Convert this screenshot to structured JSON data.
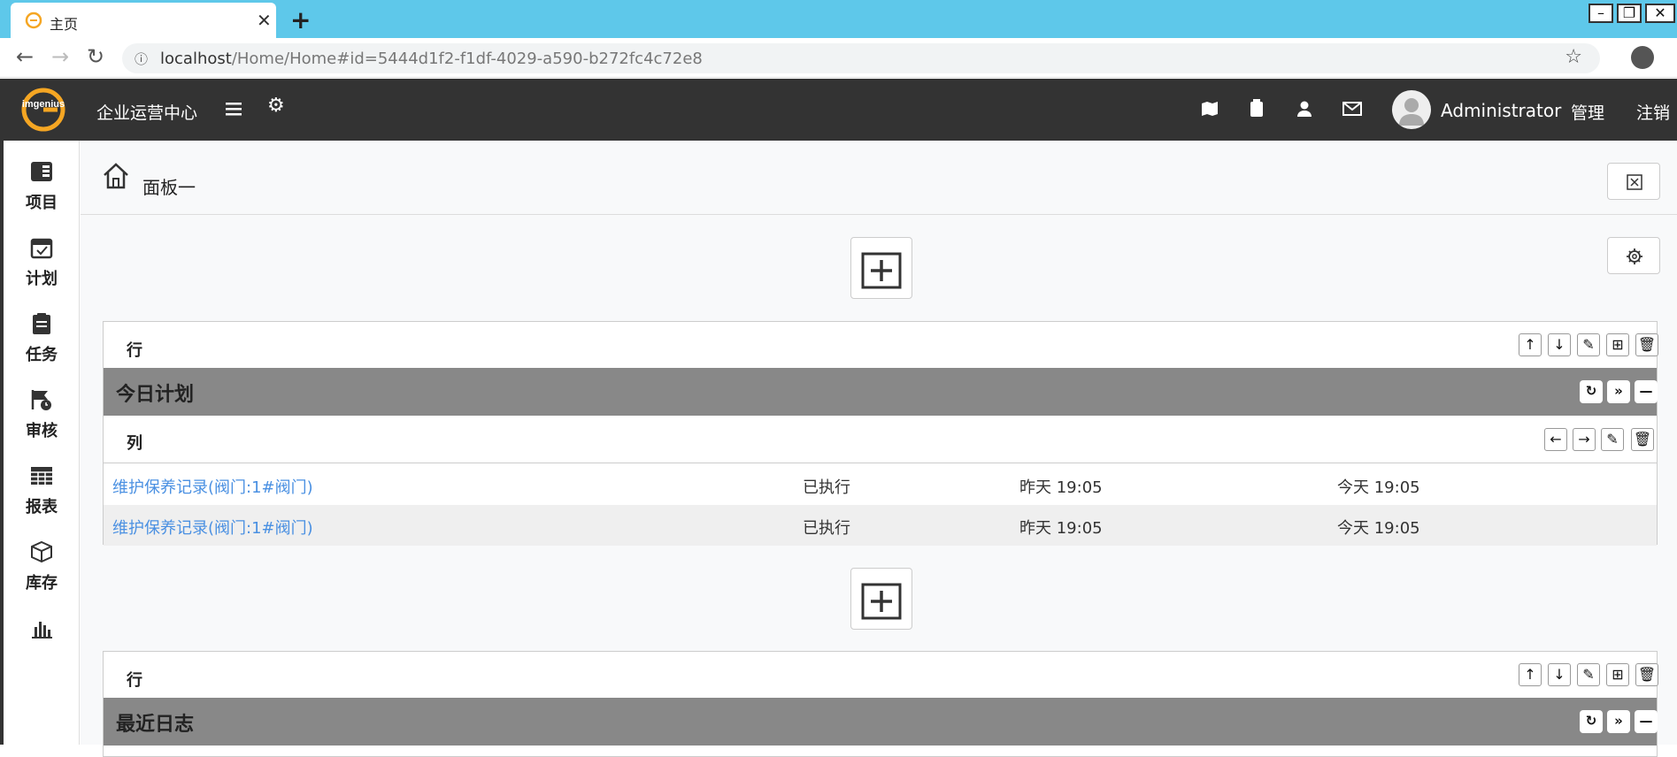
{
  "browser": {
    "tab_title": "主页",
    "new_tab": "+",
    "close_tab": "✕",
    "url_host": "localhost",
    "url_path": "/Home/Home#id=5444d1f2-f1df-4029-a590-b272fc4c72e8"
  },
  "header": {
    "logo_text": "imgenius",
    "app_title": "企业运营中心",
    "user_name": "Administrator",
    "manage": "管理",
    "logout": "注销"
  },
  "sidebar": {
    "items": [
      {
        "label": "项目",
        "icon": "project-icon"
      },
      {
        "label": "计划",
        "icon": "calendar-icon"
      },
      {
        "label": "任务",
        "icon": "clipboard-icon"
      },
      {
        "label": "审核",
        "icon": "flag-clock-icon"
      },
      {
        "label": "报表",
        "icon": "table-icon"
      },
      {
        "label": "库存",
        "icon": "box-icon"
      },
      {
        "label": "",
        "icon": "bar-chart-icon"
      }
    ]
  },
  "breadcrumb": {
    "title": "面板一"
  },
  "panels": [
    {
      "row_label": "行",
      "title": "今日计划",
      "col_label": "列",
      "rows": [
        {
          "name": "维护保养记录(阀门:1#阀门)",
          "status": "已执行",
          "start": "昨天 19:05",
          "end": "今天 19:05"
        },
        {
          "name": "维护保养记录(阀门:1#阀门)",
          "status": "已执行",
          "start": "昨天 19:05",
          "end": "今天 19:05"
        }
      ]
    },
    {
      "row_label": "行",
      "title": "最近日志"
    }
  ],
  "colors": {
    "appbar": "#333333",
    "tabbar": "#5ec8ea",
    "group_bar": "#888888",
    "link": "#4a90e2",
    "logo": "#f5a623"
  }
}
